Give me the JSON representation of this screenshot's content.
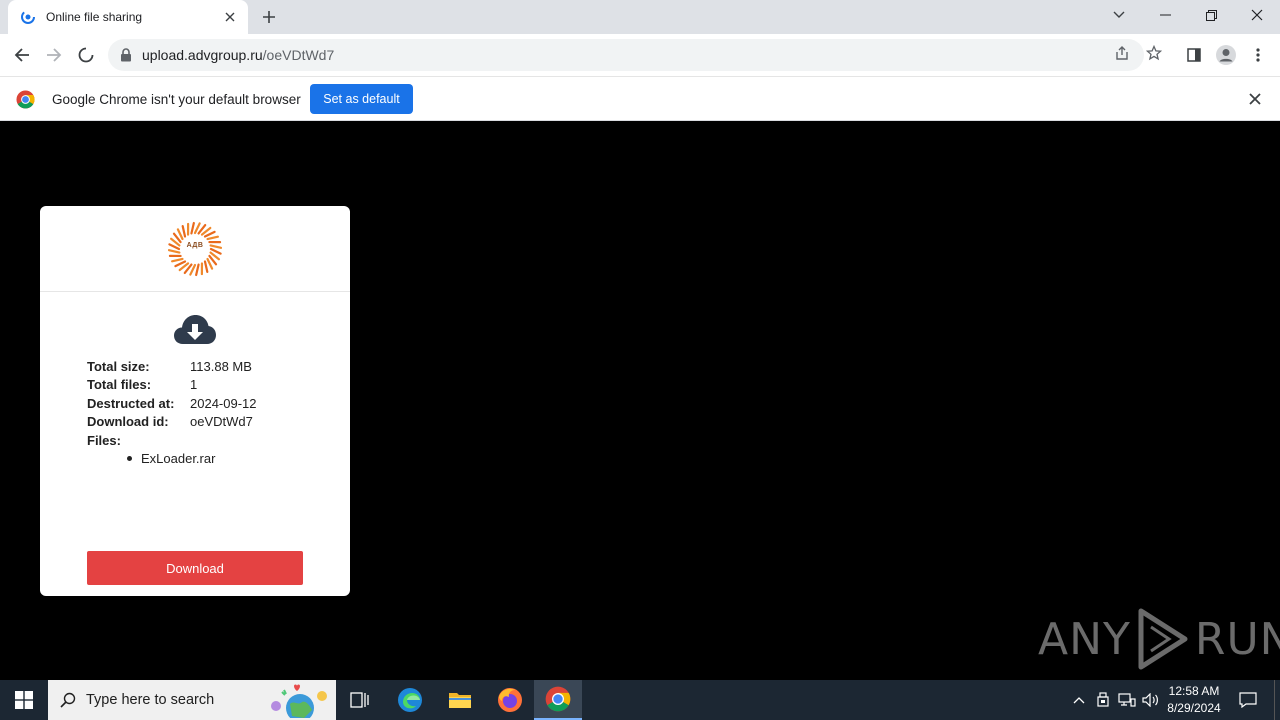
{
  "browser": {
    "tab_title": "Online file sharing",
    "url_host": "upload.advgroup.ru",
    "url_path": "/oeVDtWd7"
  },
  "infobar": {
    "message": "Google Chrome isn't your default browser",
    "button_label": "Set as default"
  },
  "page": {
    "logo_text": "АДВ",
    "details": [
      {
        "label": "Total size:",
        "value": "113.88 MB"
      },
      {
        "label": "Total files:",
        "value": "1"
      },
      {
        "label": "Destructed at:",
        "value": "2024-09-12"
      },
      {
        "label": "Download id:",
        "value": "oeVDtWd7"
      }
    ],
    "files_label": "Files:",
    "files": [
      "ExLoader.rar"
    ],
    "download_label": "Download",
    "download_color": "#e44242"
  },
  "watermark": {
    "left": "ANY",
    "right": "RUN"
  },
  "taskbar": {
    "search_placeholder": "Type here to search",
    "time": "12:58 AM",
    "date": "8/29/2024"
  }
}
